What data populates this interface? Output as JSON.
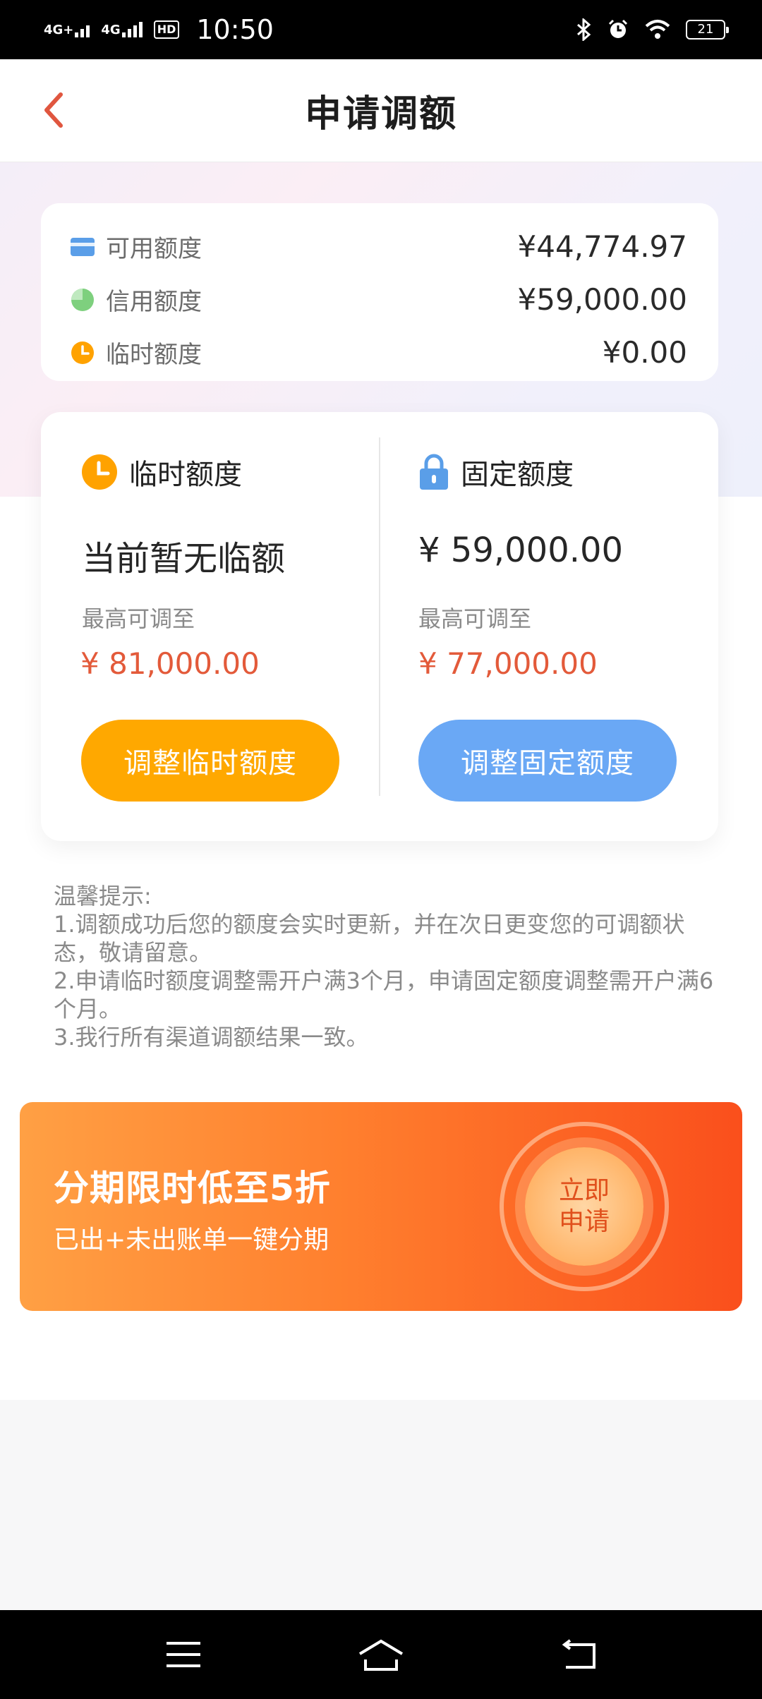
{
  "status_bar": {
    "net1": "4G+",
    "net2": "4G",
    "hd": "HD",
    "time": "10:50",
    "battery": "21"
  },
  "header": {
    "title": "申请调额"
  },
  "summary": {
    "items": [
      {
        "label": "可用额度",
        "value": "¥44,774.97",
        "icon": "card-icon",
        "color": "#5a9ee8"
      },
      {
        "label": "信用额度",
        "value": "¥59,000.00",
        "icon": "pie-icon",
        "color": "#7ed07e"
      },
      {
        "label": "临时额度",
        "value": "¥0.00",
        "icon": "clock-icon",
        "color": "#ffa200"
      }
    ]
  },
  "temp_card": {
    "title": "临时额度",
    "status": "当前暂无临额",
    "max_label": "最高可调至",
    "max_value": "¥ 81,000.00",
    "button": "调整临时额度"
  },
  "fixed_card": {
    "title": "固定额度",
    "current": "¥ 59,000.00",
    "max_label": "最高可调至",
    "max_value": "¥ 77,000.00",
    "button": "调整固定额度"
  },
  "tips": {
    "heading": "温馨提示:",
    "lines": [
      "1.调额成功后您的额度会实时更新，并在次日更变您的可调额状态，敬请留意。",
      "2.申请临时额度调整需开户满3个月，申请固定额度调整需开户满6个月。",
      "3.我行所有渠道调额结果一致。"
    ]
  },
  "promo": {
    "title": "分期限时低至5折",
    "subtitle": "已出+未出账单一键分期",
    "cta_line1": "立即",
    "cta_line2": "申请"
  },
  "colors": {
    "accent_red": "#e35a3a",
    "orange": "#ffa800",
    "blue": "#6aa8f5"
  }
}
